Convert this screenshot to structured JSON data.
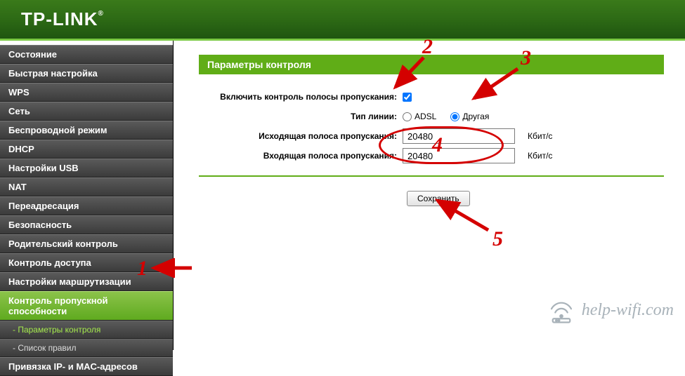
{
  "brand": "TP-LINK",
  "sidebar": {
    "items": [
      {
        "label": "Состояние"
      },
      {
        "label": "Быстрая настройка"
      },
      {
        "label": "WPS"
      },
      {
        "label": "Сеть"
      },
      {
        "label": "Беспроводной режим"
      },
      {
        "label": "DHCP"
      },
      {
        "label": "Настройки USB"
      },
      {
        "label": "NAT"
      },
      {
        "label": "Переадресация"
      },
      {
        "label": "Безопасность"
      },
      {
        "label": "Родительский контроль"
      },
      {
        "label": "Контроль доступа"
      },
      {
        "label": "Настройки маршрутизации"
      },
      {
        "label": "Контроль пропускной способности",
        "active": true
      },
      {
        "label": "Привязка IP- и MAC-адресов"
      }
    ],
    "subitems": [
      {
        "label": "- Параметры контроля",
        "selected": true
      },
      {
        "label": "- Список правил"
      }
    ]
  },
  "panel": {
    "title": "Параметры контроля",
    "enable_label": "Включить контроль полосы пропускания:",
    "enable_checked": true,
    "line_type_label": "Тип линии:",
    "line_type_options": [
      {
        "label": "ADSL",
        "checked": false
      },
      {
        "label": "Другая",
        "checked": true
      }
    ],
    "egress_label": "Исходящая полоса пропускания:",
    "egress_value": "20480",
    "ingress_label": "Входящая полоса пропускания:",
    "ingress_value": "20480",
    "unit": "Кбит/с",
    "save_label": "Сохранить"
  },
  "annotations": {
    "n1": "1",
    "n2": "2",
    "n3": "3",
    "n4": "4",
    "n5": "5"
  },
  "watermark": "help-wifi.com"
}
